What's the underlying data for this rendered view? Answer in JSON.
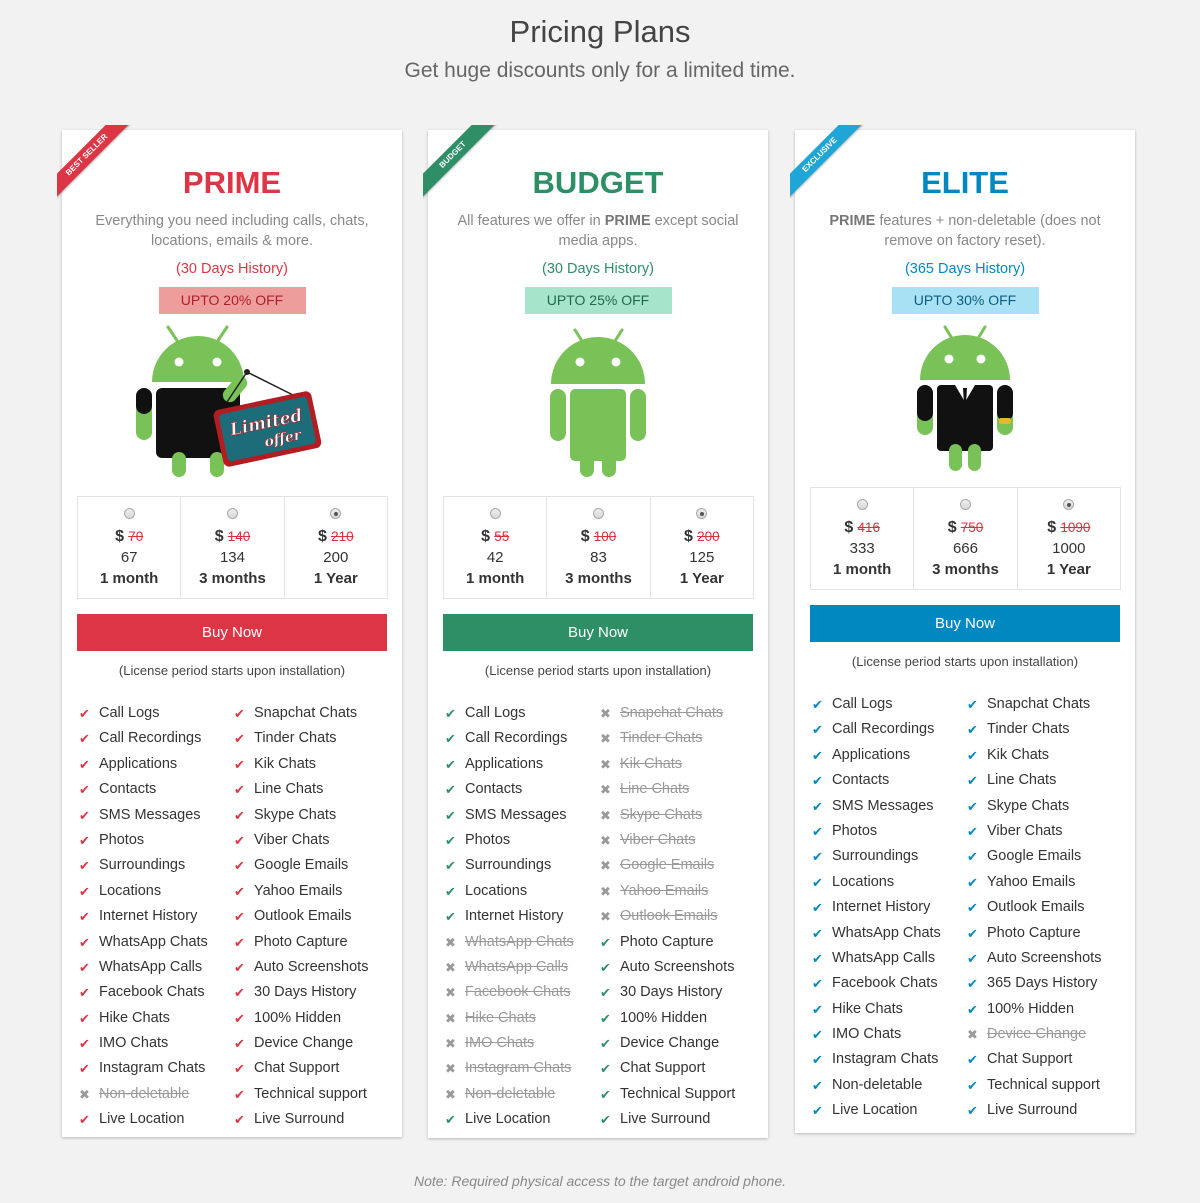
{
  "header": {
    "title": "Pricing Plans",
    "subtitle": "Get huge discounts only for a limited time."
  },
  "colors": {
    "prime": "#dc3545",
    "budget": "#2e8f66",
    "elite": "#0288c0",
    "prime_badge_bg": "#ee9d9d",
    "budget_badge_bg": "#a6e5cb",
    "elite_badge_bg": "#a8e1f3",
    "android_green": "#78c257"
  },
  "plans": [
    {
      "id": "prime",
      "ribbon": "Best Seller",
      "title": "PRIME",
      "desc_bold": "",
      "desc": "Everything you need including calls, chats, locations, emails & more.",
      "history": "(30 Days History)",
      "discount": "UPTO 20% OFF",
      "mascot": "android-limited-offer",
      "mascot_sign_line1": "Limited",
      "mascot_sign_line2": "offer",
      "options": [
        {
          "currency": "$",
          "old_price": "70",
          "price": "67",
          "period": "1 month",
          "selected": false
        },
        {
          "currency": "$",
          "old_price": "140",
          "price": "134",
          "period": "3 months",
          "selected": false
        },
        {
          "currency": "$",
          "old_price": "210",
          "price": "200",
          "period": "1 Year",
          "selected": true
        }
      ],
      "buy_label": "Buy Now",
      "license_note": "(License period starts upon installation)",
      "features_left": [
        {
          "label": "Call Logs",
          "included": true
        },
        {
          "label": "Call Recordings",
          "included": true
        },
        {
          "label": "Applications",
          "included": true
        },
        {
          "label": "Contacts",
          "included": true
        },
        {
          "label": "SMS Messages",
          "included": true
        },
        {
          "label": "Photos",
          "included": true
        },
        {
          "label": "Surroundings",
          "included": true
        },
        {
          "label": "Locations",
          "included": true
        },
        {
          "label": "Internet History",
          "included": true
        },
        {
          "label": "WhatsApp Chats",
          "included": true
        },
        {
          "label": "WhatsApp Calls",
          "included": true
        },
        {
          "label": "Facebook Chats",
          "included": true
        },
        {
          "label": "Hike Chats",
          "included": true
        },
        {
          "label": "IMO Chats",
          "included": true
        },
        {
          "label": "Instagram Chats",
          "included": true
        },
        {
          "label": "Non-deletable",
          "included": false
        },
        {
          "label": "Live Location",
          "included": true
        }
      ],
      "features_right": [
        {
          "label": "Snapchat Chats",
          "included": true
        },
        {
          "label": "Tinder Chats",
          "included": true
        },
        {
          "label": "Kik Chats",
          "included": true
        },
        {
          "label": "Line Chats",
          "included": true
        },
        {
          "label": "Skype Chats",
          "included": true
        },
        {
          "label": "Viber Chats",
          "included": true
        },
        {
          "label": "Google Emails",
          "included": true
        },
        {
          "label": "Yahoo Emails",
          "included": true
        },
        {
          "label": "Outlook Emails",
          "included": true
        },
        {
          "label": "Photo Capture",
          "included": true
        },
        {
          "label": "Auto Screenshots",
          "included": true
        },
        {
          "label": "30 Days History",
          "included": true
        },
        {
          "label": "100% Hidden",
          "included": true
        },
        {
          "label": "Device Change",
          "included": true
        },
        {
          "label": "Chat Support",
          "included": true
        },
        {
          "label": "Technical support",
          "included": true
        },
        {
          "label": "Live Surround",
          "included": true
        }
      ]
    },
    {
      "id": "budget",
      "ribbon": "Budget",
      "title": "BUDGET",
      "desc_pre": "All features we offer in ",
      "desc_bold": "PRIME",
      "desc": " except social media apps.",
      "history": "(30 Days History)",
      "discount": "UPTO 25% OFF",
      "mascot": "android-plain",
      "options": [
        {
          "currency": "$",
          "old_price": "55",
          "price": "42",
          "period": "1 month",
          "selected": false
        },
        {
          "currency": "$",
          "old_price": "100",
          "price": "83",
          "period": "3 months",
          "selected": false
        },
        {
          "currency": "$",
          "old_price": "200",
          "price": "125",
          "period": "1 Year",
          "selected": true
        }
      ],
      "buy_label": "Buy Now",
      "license_note": "(License period starts upon installation)",
      "features_left": [
        {
          "label": "Call Logs",
          "included": true
        },
        {
          "label": "Call Recordings",
          "included": true
        },
        {
          "label": "Applications",
          "included": true
        },
        {
          "label": "Contacts",
          "included": true
        },
        {
          "label": "SMS Messages",
          "included": true
        },
        {
          "label": "Photos",
          "included": true
        },
        {
          "label": "Surroundings",
          "included": true
        },
        {
          "label": "Locations",
          "included": true
        },
        {
          "label": "Internet History",
          "included": true
        },
        {
          "label": "WhatsApp Chats",
          "included": false
        },
        {
          "label": "WhatsApp Calls",
          "included": false
        },
        {
          "label": "Facebook Chats",
          "included": false
        },
        {
          "label": "Hike Chats",
          "included": false
        },
        {
          "label": "IMO Chats",
          "included": false
        },
        {
          "label": "Instagram Chats",
          "included": false
        },
        {
          "label": "Non-deletable",
          "included": false
        },
        {
          "label": "Live Location",
          "included": true
        }
      ],
      "features_right": [
        {
          "label": "Snapchat Chats",
          "included": false
        },
        {
          "label": "Tinder Chats",
          "included": false
        },
        {
          "label": "Kik Chats",
          "included": false
        },
        {
          "label": "Line Chats",
          "included": false
        },
        {
          "label": "Skype Chats",
          "included": false
        },
        {
          "label": "Viber Chats",
          "included": false
        },
        {
          "label": "Google Emails",
          "included": false
        },
        {
          "label": "Yahoo Emails",
          "included": false
        },
        {
          "label": "Outlook Emails",
          "included": false
        },
        {
          "label": "Photo Capture",
          "included": true
        },
        {
          "label": "Auto Screenshots",
          "included": true
        },
        {
          "label": "30 Days History",
          "included": true
        },
        {
          "label": "100% Hidden",
          "included": true
        },
        {
          "label": "Device Change",
          "included": true
        },
        {
          "label": "Chat Support",
          "included": true
        },
        {
          "label": "Technical Support",
          "included": true
        },
        {
          "label": "Live Surround",
          "included": true
        }
      ]
    },
    {
      "id": "elite",
      "ribbon": "Exclusive",
      "title": "ELITE",
      "desc_pre": "",
      "desc_bold": "PRIME",
      "desc": " features + non-deletable (does not remove on factory reset).",
      "history": "(365 Days History)",
      "discount": "UPTO 30% OFF",
      "mascot": "android-suit",
      "options": [
        {
          "currency": "$",
          "old_price": "416",
          "price": "333",
          "period": "1 month",
          "selected": false
        },
        {
          "currency": "$",
          "old_price": "750",
          "price": "666",
          "period": "3 months",
          "selected": false
        },
        {
          "currency": "$",
          "old_price": "1090",
          "price": "1000",
          "period": "1 Year",
          "selected": true
        }
      ],
      "buy_label": "Buy Now",
      "license_note": "(License period starts upon installation)",
      "features_left": [
        {
          "label": "Call Logs",
          "included": true
        },
        {
          "label": "Call Recordings",
          "included": true
        },
        {
          "label": "Applications",
          "included": true
        },
        {
          "label": "Contacts",
          "included": true
        },
        {
          "label": "SMS Messages",
          "included": true
        },
        {
          "label": "Photos",
          "included": true
        },
        {
          "label": "Surroundings",
          "included": true
        },
        {
          "label": "Locations",
          "included": true
        },
        {
          "label": "Internet History",
          "included": true
        },
        {
          "label": "WhatsApp Chats",
          "included": true
        },
        {
          "label": "WhatsApp Calls",
          "included": true
        },
        {
          "label": "Facebook Chats",
          "included": true
        },
        {
          "label": "Hike Chats",
          "included": true
        },
        {
          "label": "IMO Chats",
          "included": true
        },
        {
          "label": "Instagram Chats",
          "included": true
        },
        {
          "label": "Non-deletable",
          "included": true
        },
        {
          "label": "Live Location",
          "included": true
        }
      ],
      "features_right": [
        {
          "label": "Snapchat Chats",
          "included": true
        },
        {
          "label": "Tinder Chats",
          "included": true
        },
        {
          "label": "Kik Chats",
          "included": true
        },
        {
          "label": "Line Chats",
          "included": true
        },
        {
          "label": "Skype Chats",
          "included": true
        },
        {
          "label": "Viber Chats",
          "included": true
        },
        {
          "label": "Google Emails",
          "included": true
        },
        {
          "label": "Yahoo Emails",
          "included": true
        },
        {
          "label": "Outlook Emails",
          "included": true
        },
        {
          "label": "Photo Capture",
          "included": true
        },
        {
          "label": "Auto Screenshots",
          "included": true
        },
        {
          "label": "365 Days History",
          "included": true
        },
        {
          "label": "100% Hidden",
          "included": true
        },
        {
          "label": "Device Change",
          "included": false
        },
        {
          "label": "Chat Support",
          "included": true
        },
        {
          "label": "Technical support",
          "included": true
        },
        {
          "label": "Live Surround",
          "included": true
        }
      ]
    }
  ],
  "icons": {
    "included": "check-icon",
    "excluded": "times-icon"
  },
  "footer": {
    "note": "Note: Required physical access to the target android phone."
  }
}
